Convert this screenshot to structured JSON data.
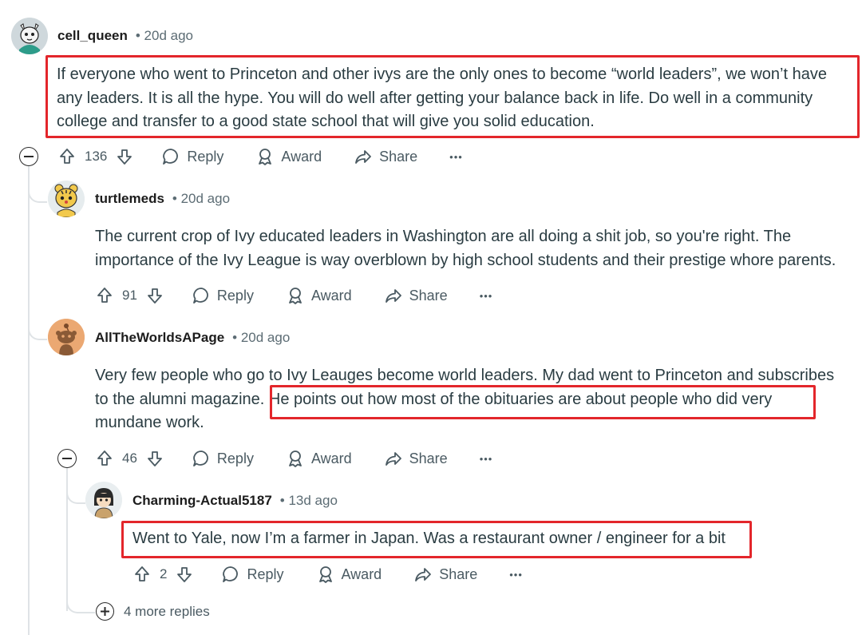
{
  "comments": [
    {
      "username": "cell_queen",
      "age": "• 20d ago",
      "lines": [
        "If everyone who went to Princeton and other ivys are the only ones to become “world leaders”, we won’t have",
        "any leaders. It is all the hype. You will do well after getting your balance back in life. Do well in a community",
        "college and transfer to a good state school that will give you solid education."
      ],
      "votes": "136"
    },
    {
      "username": "turtlemeds",
      "age": "• 20d ago",
      "lines": [
        "The current crop of Ivy educated leaders in Washington are all doing a shit job, so you're right. The",
        "importance of the Ivy League is way overblown by high school students and their prestige whore parents."
      ],
      "votes": "91"
    },
    {
      "username": "AllTheWorldsAPage",
      "age": "• 20d ago",
      "line1": "Very few people who go to Ivy Leauges become world leaders. My dad went to Princeton and subscribes",
      "line2_a": "to the alumni magazine.",
      "line2_b": "He points out how most of the obituaries are about people who did very",
      "line3": "mundane work.",
      "votes": "46"
    },
    {
      "username": "Charming-Actual5187",
      "age": "• 13d ago",
      "lines": [
        "Went to Yale, now I’m a farmer in Japan. Was a restaurant owner / engineer for a bit"
      ],
      "votes": "2"
    }
  ],
  "actions": {
    "reply": "Reply",
    "award": "Award",
    "share": "Share",
    "more": "•••"
  },
  "more_replies": "4 more replies",
  "colors": {
    "highlight_box": "#e3262b",
    "thread_line": "#dfe3e6",
    "meta_text": "#5c6c74"
  }
}
